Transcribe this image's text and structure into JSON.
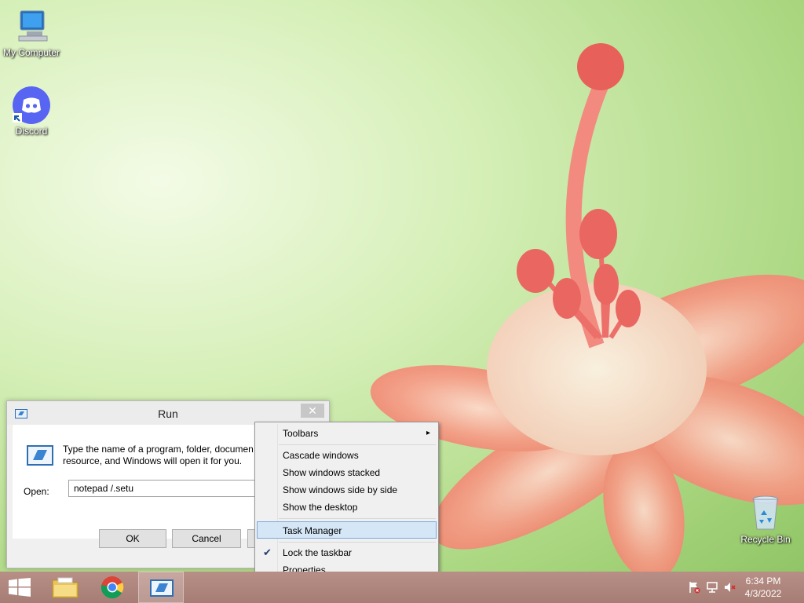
{
  "desktop": {
    "icons": [
      {
        "label": "My Computer"
      },
      {
        "label": "Discord"
      },
      {
        "label": "Recycle Bin"
      }
    ]
  },
  "run_dialog": {
    "title": "Run",
    "close_glyph": "✕",
    "description_line1": "Type the name of a program, folder, documen",
    "description_line2": "resource, and Windows will open it for you.",
    "open_label": "Open:",
    "input_value": "notepad /.setu",
    "ok_label": "OK",
    "cancel_label": "Cancel"
  },
  "context_menu": {
    "items": [
      {
        "label": "Toolbars",
        "submenu": true
      },
      {
        "label": "Cascade windows"
      },
      {
        "label": "Show windows stacked"
      },
      {
        "label": "Show windows side by side"
      },
      {
        "label": "Show the desktop"
      },
      {
        "label": "Task Manager",
        "highlighted": true
      },
      {
        "label": "Lock the taskbar",
        "checked": true
      },
      {
        "label": "Properties"
      }
    ],
    "submenu_arrow": "▸",
    "check_glyph": "✔"
  },
  "taskbar": {
    "clock_time": "6:34 PM",
    "clock_date": "4/3/2022"
  },
  "colors": {
    "accent_highlight": "#d5e6f7",
    "taskbar": "#b08880",
    "discord": "#5865f2"
  }
}
